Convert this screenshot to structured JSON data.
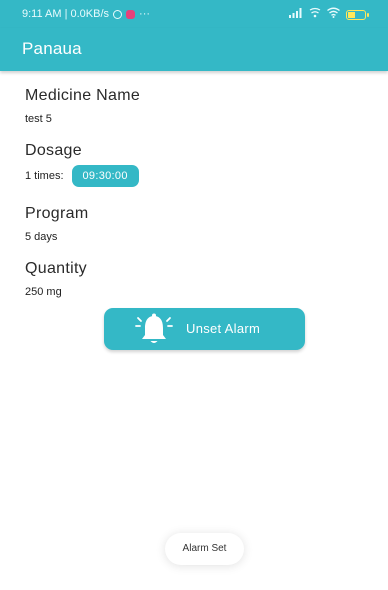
{
  "status_bar": {
    "time_and_speed": "9:11 AM | 0.0KB/s",
    "more_indicator": "···",
    "icons": [
      "alarm-icon",
      "instagram-icon",
      "signal-icon",
      "vibrate-icon",
      "wifi-icon",
      "battery-icon"
    ],
    "battery_level": 0.4
  },
  "app_bar": {
    "title": "Panaua"
  },
  "medicine": {
    "label": "Medicine Name",
    "value": "test 5"
  },
  "dosage": {
    "label": "Dosage",
    "times_text": "1 times:",
    "time_chip": "09:30:00"
  },
  "program": {
    "label": "Program",
    "value": "5 days"
  },
  "quantity": {
    "label": "Quantity",
    "value": "250 mg"
  },
  "alarm_button": {
    "label": "Unset Alarm",
    "icon": "bell-ringing-icon"
  },
  "toast": {
    "text": "Alarm Set"
  },
  "colors": {
    "primary": "#34b8c6",
    "text": "#2a2a2a",
    "background": "#ffffff"
  }
}
